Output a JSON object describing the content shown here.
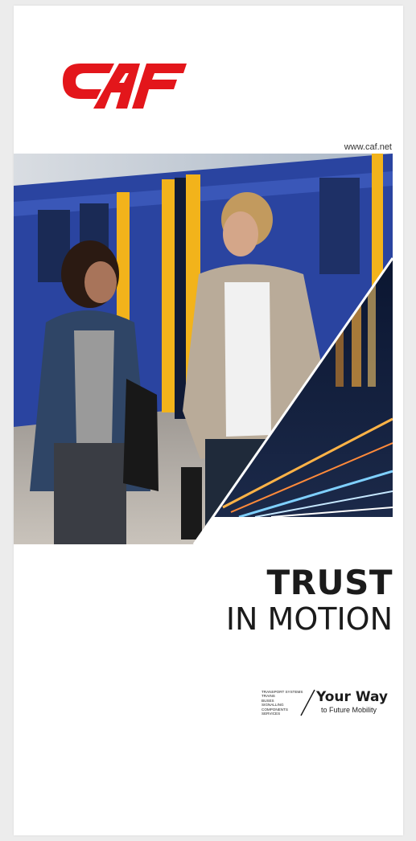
{
  "brand": {
    "logo_text": "CAF",
    "logo_color": "#e3161b",
    "website": "www.caf.net"
  },
  "headline": {
    "line1": "TRUST",
    "line2": "IN MOTION"
  },
  "tagline": {
    "divisions": [
      "TRANSPORT SYSTEMS",
      "TRAINS",
      "BUSES",
      "SIGNALLING",
      "COMPONENTS",
      "SERVICES"
    ],
    "title": "Your Way",
    "subtitle": "to Future Mobility"
  },
  "photo": {
    "subject": "two-people-on-train-platform",
    "inset": "night-city-light-trails"
  },
  "colors": {
    "train_blue": "#2a44a0",
    "train_yellow": "#f2b31b",
    "text": "#1b1b1b"
  }
}
